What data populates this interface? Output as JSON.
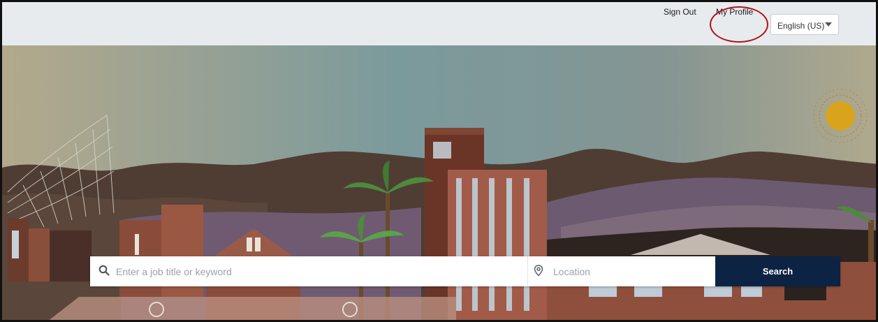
{
  "header": {
    "sign_out_label": "Sign Out",
    "my_profile_label": "My Profile",
    "language": {
      "selected": "English (US)",
      "caret_icon": "caret-down-icon"
    }
  },
  "search": {
    "keyword_placeholder": "Enter a job title or keyword",
    "keyword_icon": "search-icon",
    "location_placeholder": "Location",
    "location_icon": "location-pin-icon",
    "button_label": "Search"
  },
  "colors": {
    "topbar_bg": "#e8ebee",
    "search_button_bg": "#0c2344",
    "annotation_circle": "#b4121b",
    "sky": "#7c9b9c",
    "sun": "#d9a31b"
  }
}
